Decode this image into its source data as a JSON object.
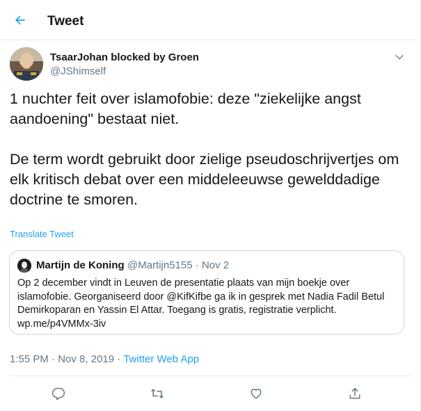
{
  "header": {
    "title": "Tweet",
    "back_icon": "arrow-left-icon"
  },
  "colors": {
    "accent": "#1da1f2",
    "text": "#14171a",
    "secondary": "#657786",
    "border": "#e6ecf0"
  },
  "tweet": {
    "author_name": "TsaarJohan blocked by Groen",
    "author_handle": "@JShimself",
    "text": "1 nuchter feit over islamofobie: deze \"ziekelijke angst aandoening\" bestaat niet.\n\nDe term wordt gebruikt door zielige pseudoschrijvertjes om elk kritisch debat over een middeleeuwse gewelddadige doctrine te smoren.",
    "translate_label": "Translate Tweet",
    "time": "1:55 PM",
    "date": "Nov 8, 2019",
    "separator": "·",
    "source": "Twitter Web App"
  },
  "quoted_tweet": {
    "author_name": "Martijn de Koning",
    "author_handle": "@Martijn5155",
    "date": "Nov 2",
    "separator": "·",
    "text": "Op 2 december vindt in Leuven de presentatie plaats van mijn boekje over islamofobie. Georganiseerd door @KifKifbe  ga ik in gesprek met Nadia Fadil Betul Demirkoparan en Yassin El Attar. Toegang is gratis, registratie verplicht. wp.me/p4VMMx-3iv"
  },
  "actions": [
    {
      "icon": "reply-icon"
    },
    {
      "icon": "retweet-icon"
    },
    {
      "icon": "like-icon"
    },
    {
      "icon": "share-icon"
    }
  ]
}
